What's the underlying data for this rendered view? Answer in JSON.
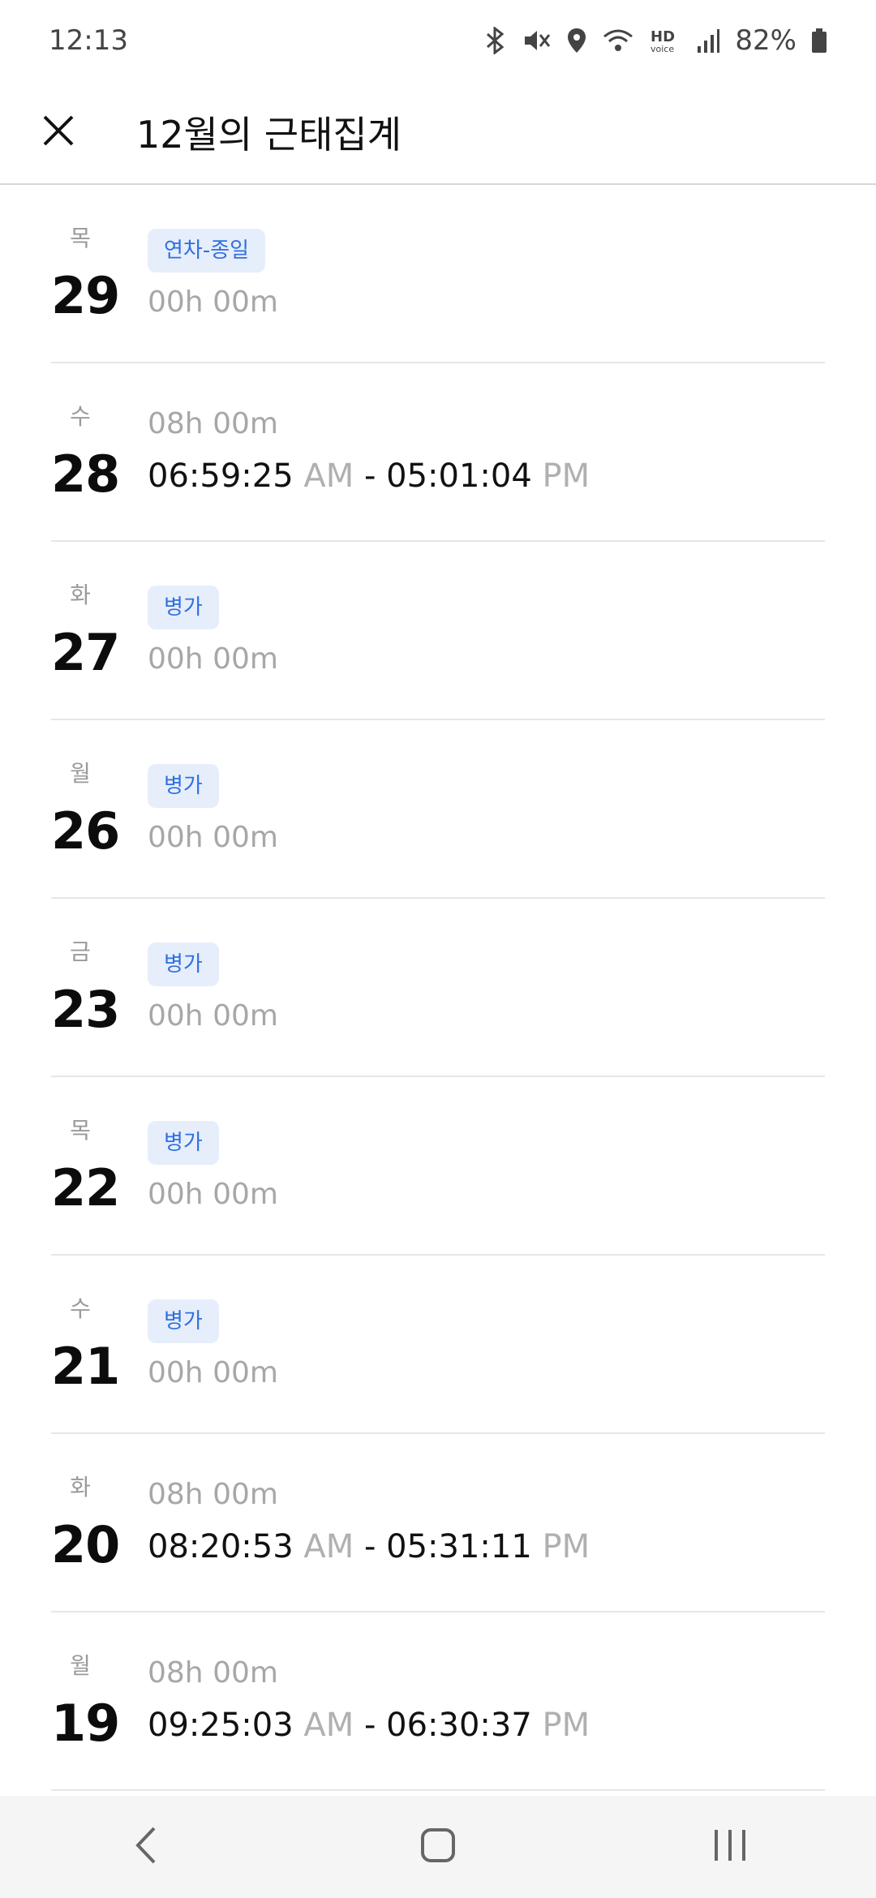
{
  "status_bar": {
    "time": "12:13",
    "battery": "82%",
    "icons": [
      "bluetooth-icon",
      "mute-icon",
      "location-icon",
      "wifi-icon",
      "hd-voice-icon",
      "signal-icon",
      "battery-icon"
    ]
  },
  "app_bar": {
    "title": "12월의 근태집계",
    "close_icon": "close-icon"
  },
  "rows": [
    {
      "dow": "목",
      "day": "29",
      "badge": "연차-종일",
      "hours": "00h 00m"
    },
    {
      "dow": "수",
      "day": "28",
      "hours": "08h 00m",
      "in_time": "06:59:25",
      "in_ampm": "AM",
      "sep": "-",
      "out_time": "05:01:04",
      "out_ampm": "PM"
    },
    {
      "dow": "화",
      "day": "27",
      "badge": "병가",
      "hours": "00h 00m"
    },
    {
      "dow": "월",
      "day": "26",
      "badge": "병가",
      "hours": "00h 00m"
    },
    {
      "dow": "금",
      "day": "23",
      "badge": "병가",
      "hours": "00h 00m"
    },
    {
      "dow": "목",
      "day": "22",
      "badge": "병가",
      "hours": "00h 00m"
    },
    {
      "dow": "수",
      "day": "21",
      "badge": "병가",
      "hours": "00h 00m"
    },
    {
      "dow": "화",
      "day": "20",
      "hours": "08h 00m",
      "in_time": "08:20:53",
      "in_ampm": "AM",
      "sep": "-",
      "out_time": "05:31:11",
      "out_ampm": "PM"
    },
    {
      "dow": "월",
      "day": "19",
      "hours": "08h 00m",
      "in_time": "09:25:03",
      "in_ampm": "AM",
      "sep": "-",
      "out_time": "06:30:37",
      "out_ampm": "PM"
    }
  ],
  "nav_bar": {
    "icons": [
      "back-icon",
      "home-icon",
      "recents-icon"
    ]
  },
  "colors": {
    "badge_bg": "#e6eefb",
    "badge_text": "#2f6fe0",
    "muted": "#a7a7a7"
  }
}
